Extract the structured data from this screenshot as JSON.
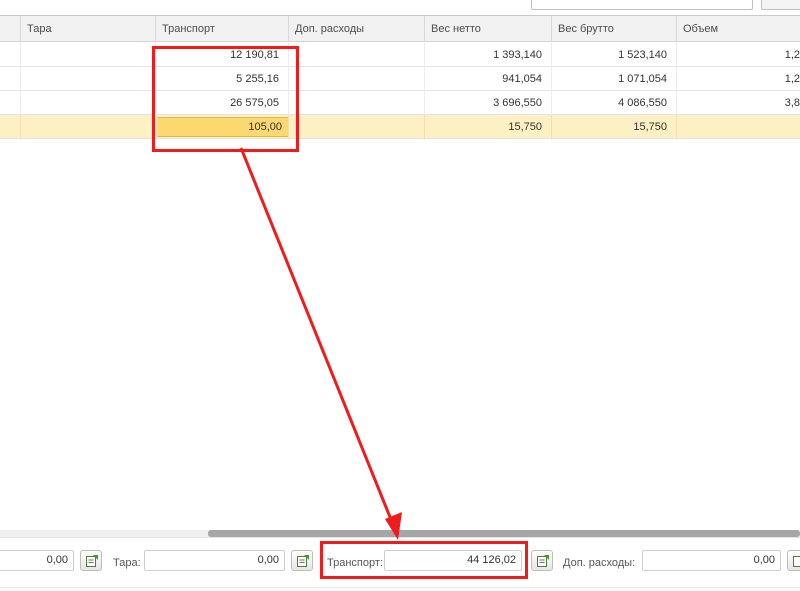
{
  "columns": [
    {
      "key": "c0",
      "label": ""
    },
    {
      "key": "tara",
      "label": "Тара"
    },
    {
      "key": "transport",
      "label": "Транспорт"
    },
    {
      "key": "dop",
      "label": "Доп. расходы"
    },
    {
      "key": "netto",
      "label": "Вес нетто"
    },
    {
      "key": "brutto",
      "label": "Вес брутто"
    },
    {
      "key": "obem",
      "label": "Объем"
    }
  ],
  "rows": [
    {
      "tara": "",
      "transport": "12 190,81",
      "dop": "",
      "netto": "1 393,140",
      "brutto": "1 523,140",
      "obem": "1,2"
    },
    {
      "tara": "",
      "transport": "5 255,16",
      "dop": "",
      "netto": "941,054",
      "brutto": "1 071,054",
      "obem": "1,2"
    },
    {
      "tara": "",
      "transport": "26 575,05",
      "dop": "",
      "netto": "3 696,550",
      "brutto": "4 086,550",
      "obem": "3,8"
    },
    {
      "tara": "",
      "transport": "105,00",
      "dop": "",
      "netto": "15,750",
      "brutto": "15,750",
      "obem": "",
      "selected": true,
      "editing": "transport"
    }
  ],
  "footer": {
    "first_value": "0,00",
    "tara_label": "Тара:",
    "tara_value": "0,00",
    "transport_label": "Транспорт:",
    "transport_value": "44 126,02",
    "dop_label": "Доп. расходы:",
    "dop_value": "0,00"
  },
  "icons": {
    "footer_buttons": "recalculate-icon"
  },
  "colors": {
    "annotation": "#ee1c1c",
    "selected_row": "#fdf0c4",
    "editing_cell": "#fbd870"
  }
}
